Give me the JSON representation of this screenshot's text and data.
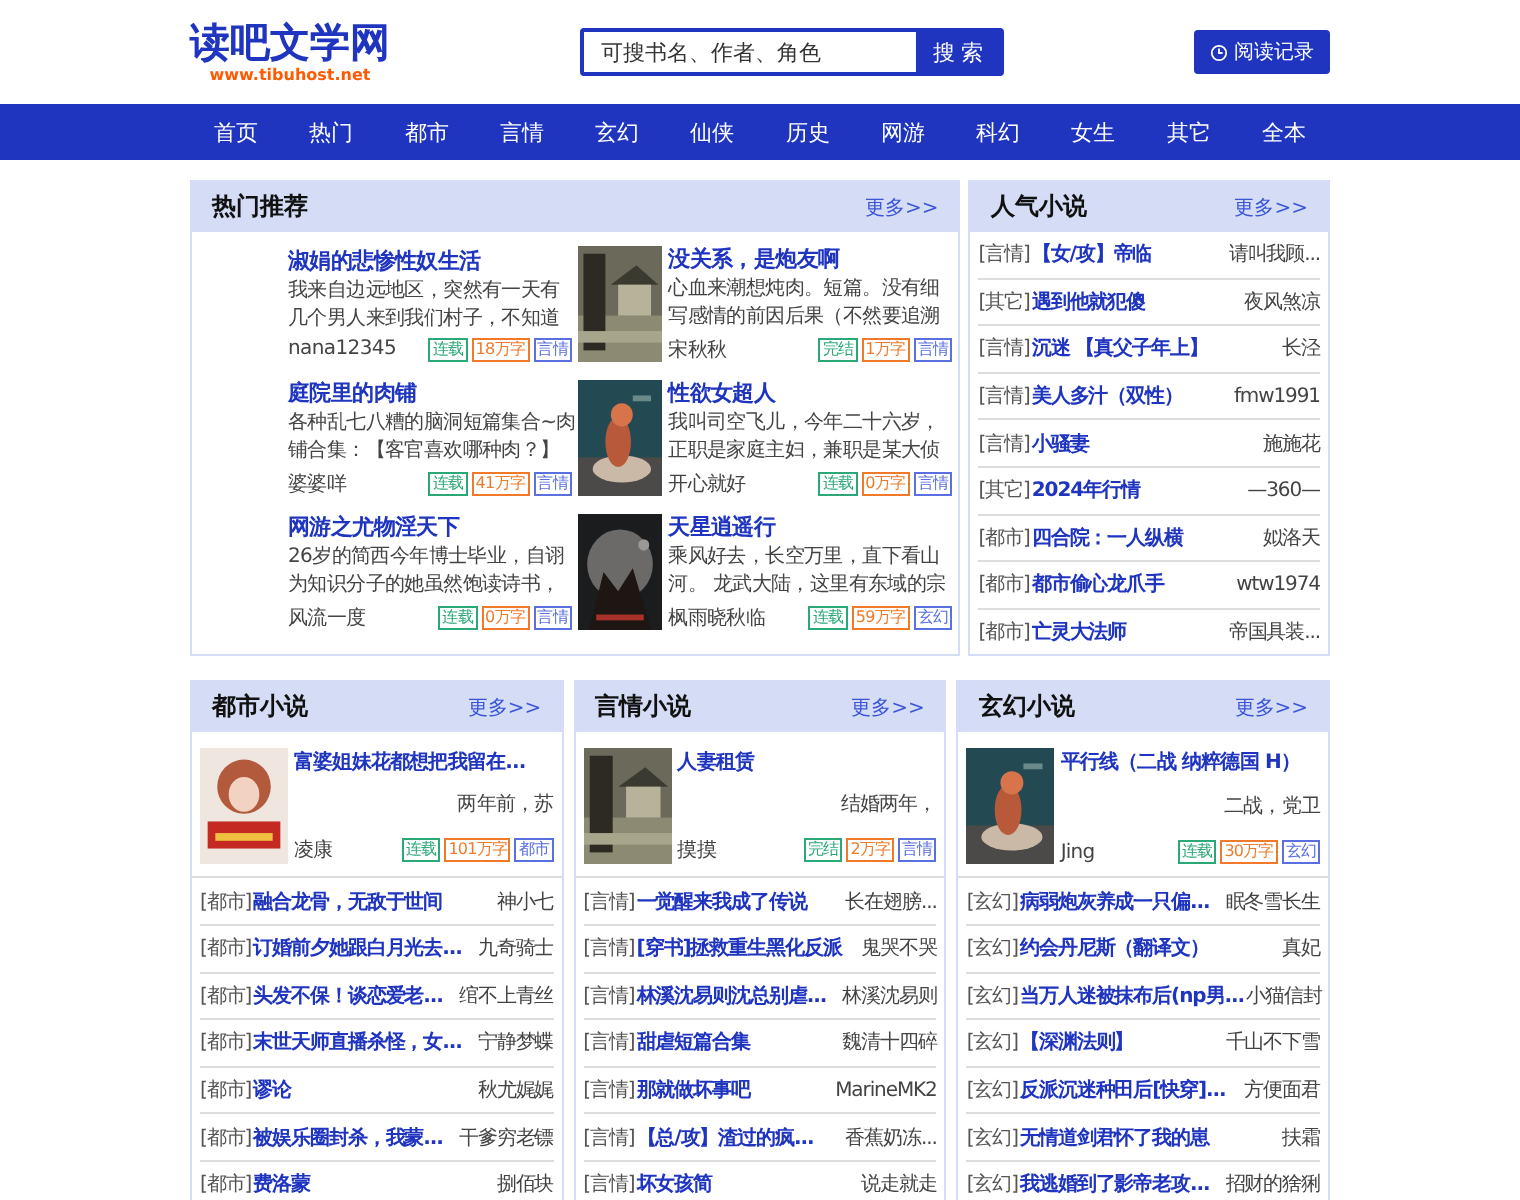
{
  "header": {
    "logo": "读吧文学网",
    "site_url": "www.tibuhost.net",
    "search": {
      "placeholder": "可搜书名、作者、角色",
      "button": "搜 索"
    },
    "history_button": "阅读记录"
  },
  "nav": [
    {
      "label": "首页"
    },
    {
      "label": "热门"
    },
    {
      "label": "都市"
    },
    {
      "label": "言情"
    },
    {
      "label": "玄幻"
    },
    {
      "label": "仙侠"
    },
    {
      "label": "历史"
    },
    {
      "label": "网游"
    },
    {
      "label": "科幻"
    },
    {
      "label": "女生"
    },
    {
      "label": "其它"
    },
    {
      "label": "全本"
    }
  ],
  "hot": {
    "title": "热门推荐",
    "more": "更多>>",
    "items": [
      {
        "cover": false,
        "title": "淑娟的悲惨性奴生活",
        "desc": [
          "我来自边远地区，突然有一天有",
          "几个男人来到我们村子，不知道"
        ],
        "author": "nana12345",
        "tags": [
          {
            "kind": "status",
            "text": "连载"
          },
          {
            "kind": "words",
            "text": "18万字"
          },
          {
            "kind": "category",
            "text": "言情"
          }
        ]
      },
      {
        "cover": true,
        "title": "没关系，是炮友啊",
        "desc": [
          "心血来潮想炖肉。短篇。没有细",
          "写感情的前因后果（不然要追溯"
        ],
        "author": "宋秋秋",
        "tags": [
          {
            "kind": "status",
            "text": "完结"
          },
          {
            "kind": "words",
            "text": "1万字"
          },
          {
            "kind": "category",
            "text": "言情"
          }
        ]
      },
      {
        "cover": false,
        "title": "庭院里的肉铺",
        "desc": [
          "各种乱七八糟的脑洞短篇集合~肉",
          "铺合集：【客官喜欢哪种肉？】"
        ],
        "author": "婆婆咩",
        "tags": [
          {
            "kind": "status",
            "text": "连载"
          },
          {
            "kind": "words",
            "text": "41万字"
          },
          {
            "kind": "category",
            "text": "言情"
          }
        ]
      },
      {
        "cover": true,
        "title": "性欲女超人",
        "desc": [
          "我叫司空飞儿，今年二十六岁，",
          "正职是家庭主妇，兼职是某大侦"
        ],
        "author": "开心就好",
        "tags": [
          {
            "kind": "status",
            "text": "连载"
          },
          {
            "kind": "words",
            "text": "0万字"
          },
          {
            "kind": "category",
            "text": "言情"
          }
        ]
      },
      {
        "cover": false,
        "title": "网游之尤物淫天下",
        "desc": [
          "26岁的简西今年博士毕业，自诩",
          "为知识分子的她虽然饱读诗书，"
        ],
        "author": "风流一度",
        "tags": [
          {
            "kind": "status",
            "text": "连载"
          },
          {
            "kind": "words",
            "text": "0万字"
          },
          {
            "kind": "category",
            "text": "言情"
          }
        ]
      },
      {
        "cover": true,
        "title": "天星逍遥行",
        "desc": [
          "乘风好去，长空万里，直下看山",
          "河。 龙武大陆，这里有东域的宗"
        ],
        "author": "枫雨晓秋临",
        "tags": [
          {
            "kind": "status",
            "text": "连载"
          },
          {
            "kind": "words",
            "text": "59万字"
          },
          {
            "kind": "category",
            "text": "玄幻"
          }
        ]
      }
    ]
  },
  "popular": {
    "title": "人气小说",
    "more": "更多>>",
    "items": [
      {
        "category": "[言情]",
        "title": "【女/攻】帝临",
        "author": "请叫我顾..."
      },
      {
        "category": "[其它]",
        "title": "遇到他就犯傻",
        "author": "夜风煞凉"
      },
      {
        "category": "[言情]",
        "title": "沉迷 【真父子年上】",
        "author": "长泾"
      },
      {
        "category": "[言情]",
        "title": "美人多汁（双性）",
        "author": "fmw1991"
      },
      {
        "category": "[言情]",
        "title": "小骚妻",
        "author": "施施花"
      },
      {
        "category": "[其它]",
        "title": "2024年行情",
        "author": "—360—"
      },
      {
        "category": "[都市]",
        "title": "四合院：一人纵横",
        "author": "姒洛天"
      },
      {
        "category": "[都市]",
        "title": "都市偷心龙爪手",
        "author": "wtw1974"
      },
      {
        "category": "[都市]",
        "title": "亡灵大法师",
        "author": "帝国具装..."
      }
    ]
  },
  "sections": [
    {
      "title": "都市小说",
      "more": "更多>>",
      "featured": {
        "title": "富婆姐妹花都想把我留在...",
        "desc": "两年前，苏",
        "author": "凌康",
        "tags": [
          {
            "kind": "status",
            "text": "连载"
          },
          {
            "kind": "words",
            "text": "101万字"
          },
          {
            "kind": "category",
            "text": "都市"
          }
        ]
      },
      "items": [
        {
          "category": "[都市]",
          "title": "融合龙骨，无敌于世间",
          "author": "神小七"
        },
        {
          "category": "[都市]",
          "title": "订婚前夕她跟白月光去...",
          "author": "九奇骑士"
        },
        {
          "category": "[都市]",
          "title": "头发不保！谈恋爱老...",
          "author": "绾不上青丝"
        },
        {
          "category": "[都市]",
          "title": "末世天师直播杀怪，女...",
          "author": "宁静梦蝶"
        },
        {
          "category": "[都市]",
          "title": "谬论",
          "author": "秋尤娓娓"
        },
        {
          "category": "[都市]",
          "title": "被娱乐圈封杀，我蒙...",
          "author": "干爹穷老镖"
        },
        {
          "category": "[都市]",
          "title": "费洛蒙",
          "author": "捌佰块"
        }
      ]
    },
    {
      "title": "言情小说",
      "more": "更多>>",
      "featured": {
        "title": "人妻租赁",
        "desc": "结婚两年，",
        "author": "摸摸",
        "tags": [
          {
            "kind": "status",
            "text": "完结"
          },
          {
            "kind": "words",
            "text": "2万字"
          },
          {
            "kind": "category",
            "text": "言情"
          }
        ]
      },
      "items": [
        {
          "category": "[言情]",
          "title": "一觉醒来我成了传说",
          "author": "长在翅膀..."
        },
        {
          "category": "[言情]",
          "title": "[穿书]拯救重生黑化反派",
          "author": "鬼哭不哭"
        },
        {
          "category": "[言情]",
          "title": "林溪沈易则沈总别虐...",
          "author": "林溪沈易则"
        },
        {
          "category": "[言情]",
          "title": "甜虐短篇合集",
          "author": "魏清十四碎"
        },
        {
          "category": "[言情]",
          "title": "那就做坏事吧",
          "author": "MarineMK2"
        },
        {
          "category": "[言情]",
          "title": "【总/攻】渣过的疯...",
          "author": "香蕉奶冻..."
        },
        {
          "category": "[言情]",
          "title": "坏女孩简",
          "author": "说走就走"
        }
      ]
    },
    {
      "title": "玄幻小说",
      "more": "更多>>",
      "featured": {
        "title": "平行线（二战 纳粹德国 H）",
        "desc": "二战，党卫",
        "author": "Jing",
        "tags": [
          {
            "kind": "status",
            "text": "连载"
          },
          {
            "kind": "words",
            "text": "30万字"
          },
          {
            "kind": "category",
            "text": "玄幻"
          }
        ]
      },
      "items": [
        {
          "category": "[玄幻]",
          "title": "病弱炮灰养成一只偏...",
          "author": "眠冬雪长生"
        },
        {
          "category": "[玄幻]",
          "title": "约会丹尼斯（翻译文）",
          "author": "真妃"
        },
        {
          "category": "[玄幻]",
          "title": "当万人迷被抹布后(np男...",
          "author": "小猫信封"
        },
        {
          "category": "[玄幻]",
          "title": "【深渊法则】",
          "author": "千山不下雪"
        },
        {
          "category": "[玄幻]",
          "title": "反派沉迷种田后[快穿]...",
          "author": "方便面君"
        },
        {
          "category": "[玄幻]",
          "title": "无情道剑君怀了我的崽",
          "author": "扶霜"
        },
        {
          "category": "[玄幻]",
          "title": "我逃婚到了影帝老攻...",
          "author": "招财的猞猁"
        }
      ]
    }
  ]
}
